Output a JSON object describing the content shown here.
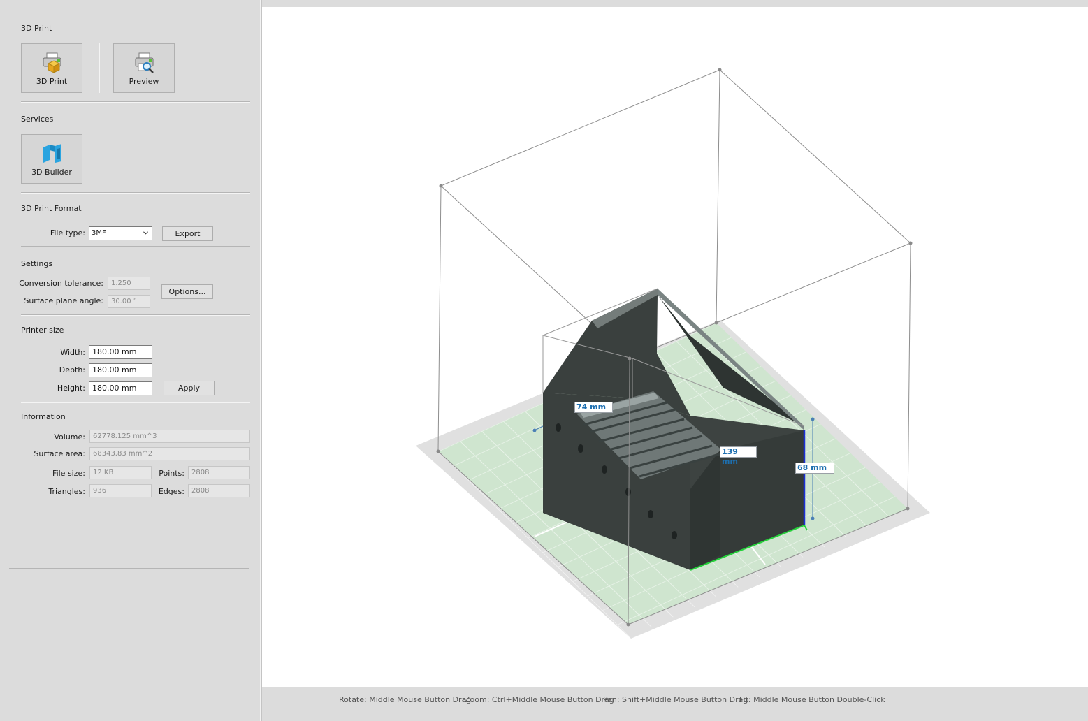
{
  "sections": {
    "print": "3D Print",
    "services": "Services",
    "format": "3D Print Format",
    "settings": "Settings",
    "printer_size": "Printer size",
    "information": "Information"
  },
  "buttons": {
    "print3d": "3D Print",
    "preview": "Preview",
    "builder": "3D Builder",
    "export": "Export",
    "options": "Options...",
    "apply": "Apply"
  },
  "format": {
    "file_type_label": "File type:",
    "file_type_value": "3MF"
  },
  "settings": {
    "tolerance_label": "Conversion tolerance:",
    "tolerance_value": "1.250",
    "angle_label": "Surface plane angle:",
    "angle_value": "30.00 °"
  },
  "printer": {
    "width_label": "Width:",
    "width_value": "180.00 mm",
    "depth_label": "Depth:",
    "depth_value": "180.00 mm",
    "height_label": "Height:",
    "height_value": "180.00 mm"
  },
  "info": {
    "volume_label": "Volume:",
    "volume_value": "62778.125 mm^3",
    "area_label": "Surface area:",
    "area_value": "68343.83 mm^2",
    "filesize_label": "File size:",
    "filesize_value": "12 KB",
    "points_label": "Points:",
    "points_value": "2808",
    "triangles_label": "Triangles:",
    "triangles_value": "936",
    "edges_label": "Edges:",
    "edges_value": "2808"
  },
  "viewport": {
    "dim_width": "74 mm",
    "dim_depth": "139 mm",
    "dim_height": "68 mm",
    "model_color": "#3a403e",
    "bed_color": "#cfe5cf"
  },
  "hints": {
    "rotate": "Rotate: Middle Mouse Button Drag",
    "zoom": "Zoom: Ctrl+Middle Mouse Button Drag",
    "pan": "Pan: Shift+Middle Mouse Button Drag",
    "fit": "Fit: Middle Mouse Button Double-Click"
  },
  "icons": {
    "print3d": "printer-3d-icon",
    "preview": "printer-preview-icon",
    "builder": "builder-3d-icon",
    "dropdown": "chevron-down-icon"
  }
}
